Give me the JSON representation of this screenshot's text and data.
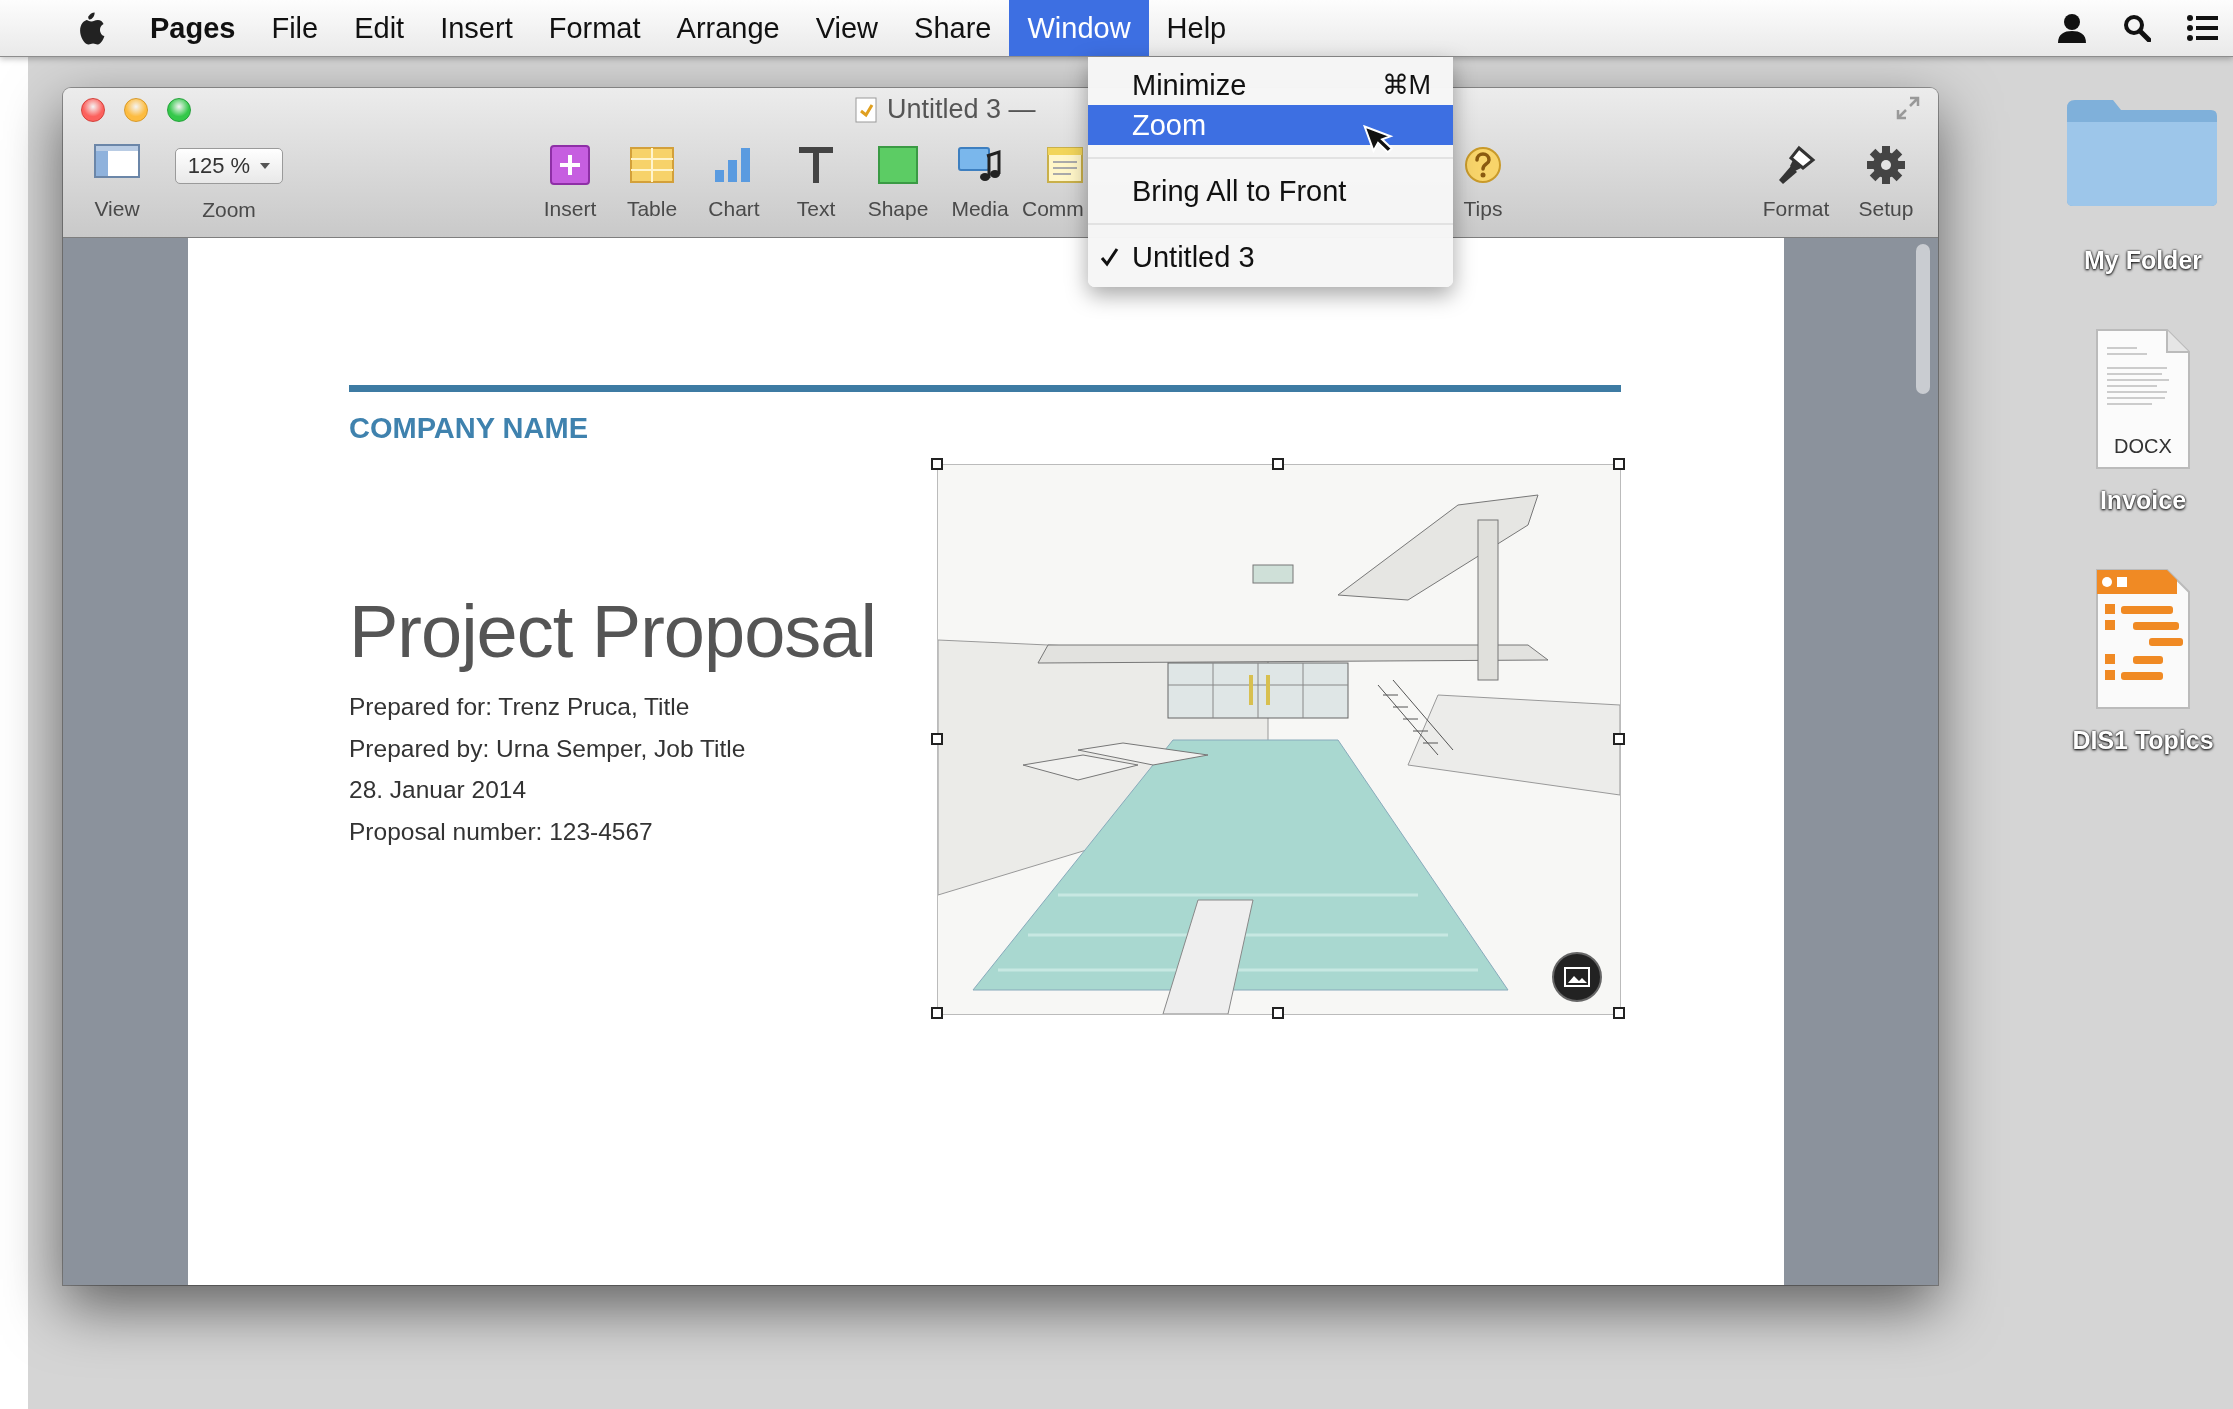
{
  "menubar": {
    "items": [
      {
        "label": "Pages",
        "kind": "app",
        "selected": false
      },
      {
        "label": "File",
        "kind": "menu",
        "selected": false
      },
      {
        "label": "Edit",
        "kind": "menu",
        "selected": false
      },
      {
        "label": "Insert",
        "kind": "menu",
        "selected": false
      },
      {
        "label": "Format",
        "kind": "menu",
        "selected": false
      },
      {
        "label": "Arrange",
        "kind": "menu",
        "selected": false
      },
      {
        "label": "View",
        "kind": "menu",
        "selected": false
      },
      {
        "label": "Share",
        "kind": "menu",
        "selected": false
      },
      {
        "label": "Window",
        "kind": "menu",
        "selected": true
      },
      {
        "label": "Help",
        "kind": "menu",
        "selected": false
      }
    ]
  },
  "window": {
    "title": "Untitled 3 —",
    "toolbar": [
      {
        "kind": "view",
        "label": "View"
      },
      {
        "kind": "zoom",
        "label": "Zoom",
        "value": "125 %"
      },
      {
        "kind": "insert",
        "label": "Insert"
      },
      {
        "kind": "table",
        "label": "Table"
      },
      {
        "kind": "chart",
        "label": "Chart"
      },
      {
        "kind": "text",
        "label": "Text"
      },
      {
        "kind": "shape",
        "label": "Shape"
      },
      {
        "kind": "media",
        "label": "Media"
      },
      {
        "kind": "comment",
        "label": "Comm"
      },
      {
        "kind": "tips",
        "label": "Tips"
      },
      {
        "kind": "format",
        "label": "Format"
      },
      {
        "kind": "setup",
        "label": "Setup"
      }
    ],
    "document": {
      "company": "COMPANY NAME",
      "title": "Project Proposal",
      "details": [
        "Prepared for: Trenz Pruca, Title",
        "Prepared by: Urna Semper, Job Title",
        "28. Januar 2014",
        "Proposal number: 123-4567"
      ]
    }
  },
  "window_menu": {
    "groups": [
      {
        "items": [
          {
            "label": "Minimize",
            "shortcut": "⌘M",
            "selected": false,
            "checked": false
          },
          {
            "label": "Zoom",
            "selected": true,
            "checked": false
          }
        ]
      },
      {
        "items": [
          {
            "label": "Bring All to Front",
            "selected": false,
            "checked": false
          }
        ]
      },
      {
        "items": [
          {
            "label": "Untitled 3",
            "selected": false,
            "checked": true
          }
        ]
      }
    ]
  },
  "desktop_icons": [
    {
      "kind": "folder",
      "label": "My Folder"
    },
    {
      "kind": "docx",
      "label": "Invoice",
      "badge": "DOCX"
    },
    {
      "kind": "outline",
      "label": "DIS1 Topics"
    }
  ]
}
